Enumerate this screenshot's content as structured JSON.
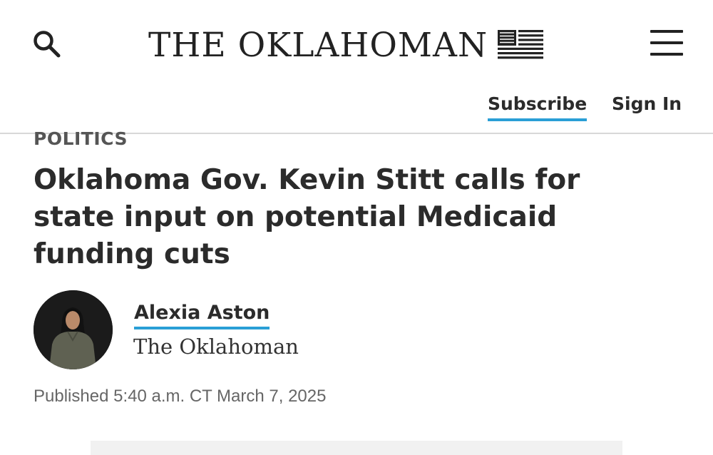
{
  "header": {
    "logo_text": "THE OKLAHOMAN",
    "logo_icon": "flag-stripes-icon",
    "search_icon": "search-icon",
    "menu_icon": "hamburger-menu-icon",
    "subscribe_label": "Subscribe",
    "signin_label": "Sign In"
  },
  "article": {
    "section": "POLITICS",
    "headline": "Oklahoma Gov. Kevin Stitt calls for state input on potential Medicaid funding cuts",
    "author": {
      "name": "Alexia Aston",
      "organization": "The Oklahoman"
    },
    "published_prefix": "Published",
    "published_time": "5:40 a.m. CT March 7, 2025"
  },
  "colors": {
    "accent": "#2a9fd6",
    "text": "#2b2b2b",
    "muted": "#666666",
    "divider": "#d8d8d8"
  }
}
